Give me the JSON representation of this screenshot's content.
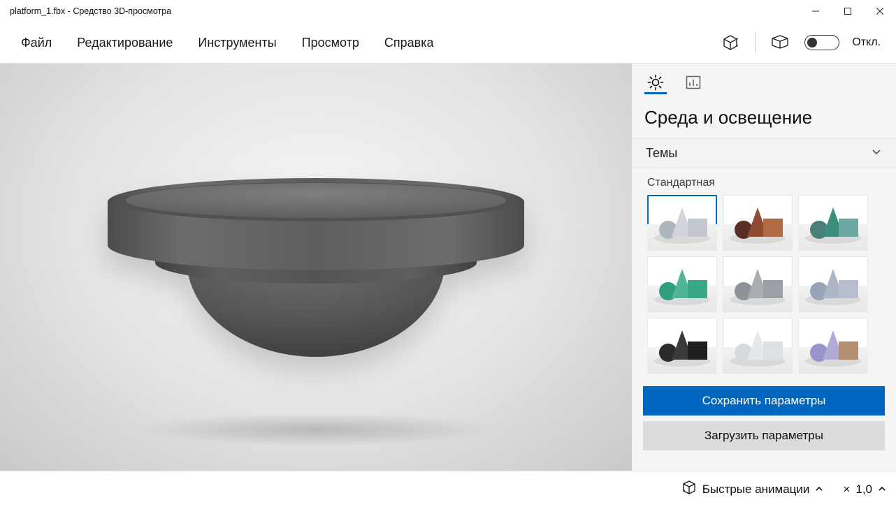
{
  "window": {
    "title": "platform_1.fbx - Средство 3D-просмотра"
  },
  "menu": {
    "file": "Файл",
    "edit": "Редактирование",
    "tools": "Инструменты",
    "view": "Просмотр",
    "help": "Справка",
    "toggle_label": "Откл."
  },
  "panel": {
    "title": "Среда и освещение",
    "themes_header": "Темы",
    "themes_caption": "Стандартная",
    "save_btn": "Сохранить параметры",
    "load_btn": "Загрузить параметры",
    "themes": [
      {
        "name": "default",
        "sphere": "#aeb5bb",
        "cone": "#cfd5da",
        "cube": "#c2c8cd"
      },
      {
        "name": "warm",
        "sphere": "#5a2e24",
        "cone": "#8f4a34",
        "cube": "#b06b43"
      },
      {
        "name": "teal",
        "sphere": "#4b7e7a",
        "cone": "#3b8d7c",
        "cube": "#6aa8a0"
      },
      {
        "name": "green",
        "sphere": "#2f9e7f",
        "cone": "#4fb49a",
        "cube": "#3aa886"
      },
      {
        "name": "grey",
        "sphere": "#8e9399",
        "cone": "#a9adb2",
        "cube": "#9aa0a6"
      },
      {
        "name": "bluegrey",
        "sphere": "#9aa4b8",
        "cone": "#adb6c7",
        "cube": "#b7becd"
      },
      {
        "name": "dark",
        "sphere": "#2b2b2b",
        "cone": "#3a3a3a",
        "cube": "#1f1f1f"
      },
      {
        "name": "light",
        "sphere": "#d6dadd",
        "cone": "#e5e8ea",
        "cube": "#dde1e4"
      },
      {
        "name": "violet",
        "sphere": "#9a95c8",
        "cone": "#b2a9d6",
        "cube": "#b48f72"
      }
    ]
  },
  "status": {
    "anim_label": "Быстрые анимации",
    "zoom_prefix": "×",
    "zoom_value": "1,0"
  }
}
